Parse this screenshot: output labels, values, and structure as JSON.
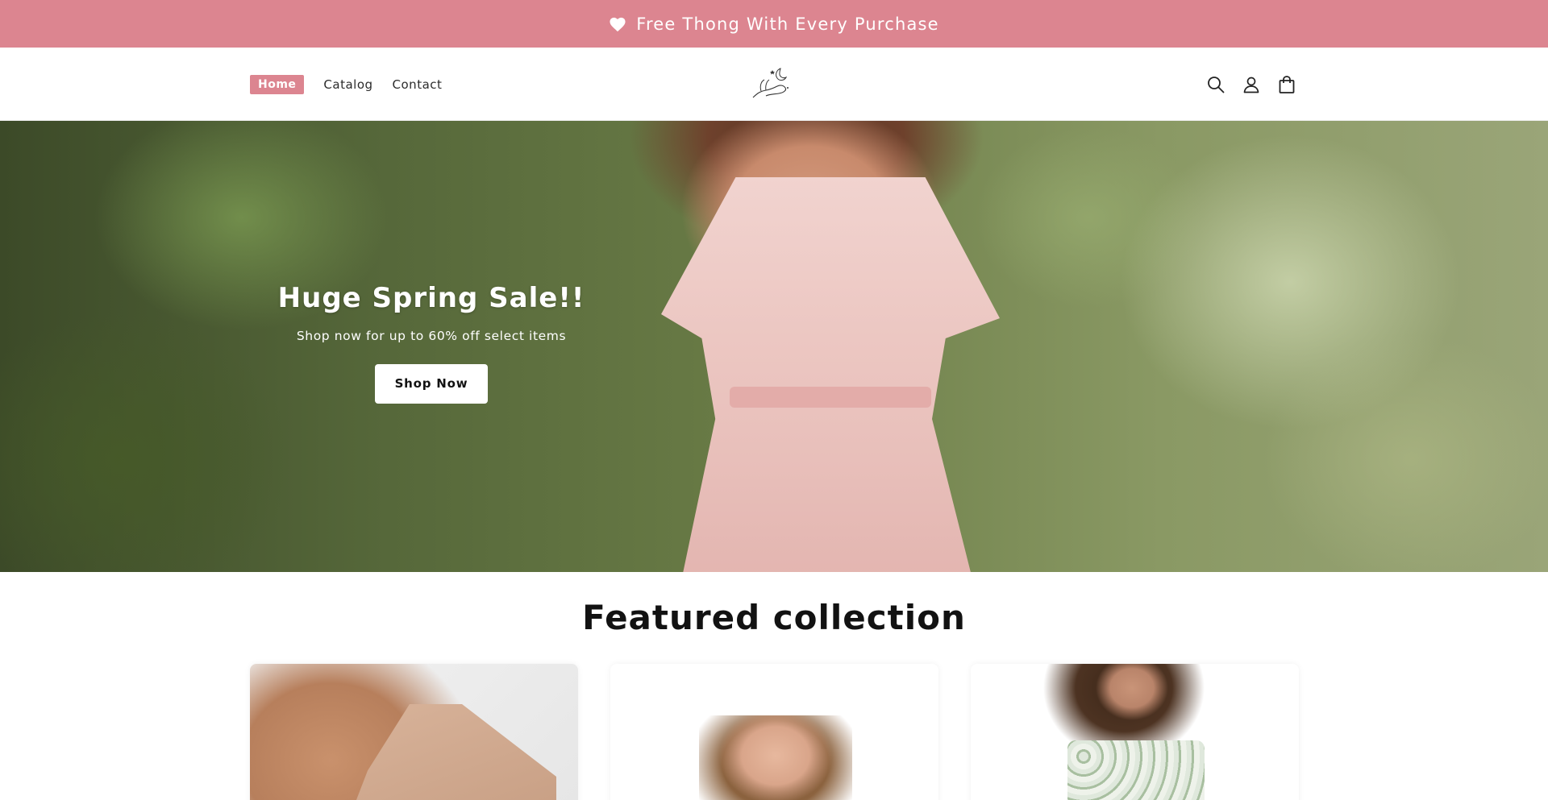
{
  "announcement": {
    "text": "Free Thong With Every Purchase",
    "icon": "heart-icon"
  },
  "header": {
    "nav": [
      {
        "label": "Home",
        "active": true
      },
      {
        "label": "Catalog",
        "active": false
      },
      {
        "label": "Contact",
        "active": false
      }
    ],
    "logo_icon": "hand-and-moon-logo",
    "icons": [
      "search-icon",
      "account-icon",
      "cart-icon"
    ]
  },
  "hero": {
    "title": "Huge Spring Sale!!",
    "subtitle": "Shop now for up to 60% off select items",
    "button_label": "Shop Now"
  },
  "featured": {
    "title": "Featured collection",
    "cards": [
      {
        "image": "product-image-bra"
      },
      {
        "image": "product-image-model-smiling"
      },
      {
        "image": "product-image-floral-dress"
      }
    ]
  },
  "colors": {
    "accent": "#dc8590",
    "text": "#121212",
    "background": "#ffffff"
  }
}
